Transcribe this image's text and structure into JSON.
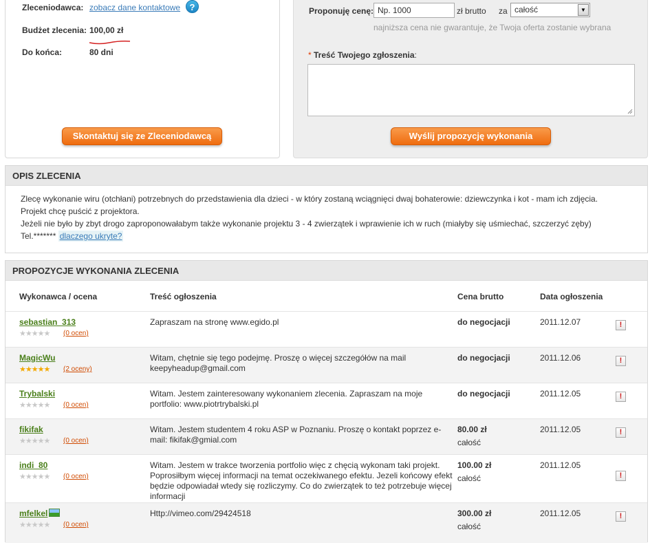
{
  "client": {
    "client_label": "Zleceniodawca:",
    "client_link": "zobacz dane kontaktowe",
    "help_icon": "?",
    "budget_label": "Budżet zlecenia:",
    "budget_value": "100,00 zł",
    "remaining_label": "Do końca:",
    "remaining_value": "80 dni",
    "contact_button": "Skontaktuj się ze Zleceniodawcą"
  },
  "proposal_form": {
    "price_label": "Proponuję cenę:",
    "price_placeholder": "Np. 1000",
    "brutto_label": "zł brutto",
    "za_label": "za",
    "scope_selected": "całość",
    "hint": "najniższa cena nie gwarantuje, że Twoja oferta zostanie wybrana",
    "required_mark": "*",
    "message_label": "Treść Twojego zgłoszenia",
    "colon": ":",
    "submit_button": "Wyślij propozycję wykonania"
  },
  "description": {
    "heading": "OPIS ZLECENIA",
    "lines": [
      "Zlecę wykonanie wiru (otchłani) potrzebnych do przedstawienia dla dzieci - w który zostaną wciągnięci dwaj bohaterowie: dziewczynka i kot - mam ich zdjęcia.",
      "Projekt chcę puścić z projektora.",
      "Jeżeli nie było by zbyt drogo zaproponowałabym także wykonanie projektu 3 - 4 zwierzątek i wprawienie ich w ruch (miałyby się uśmiechać, szczerzyć zęby)"
    ],
    "tel_label": "Tel.*******",
    "why_hidden_link": "dlaczego ukryte?"
  },
  "proposals": {
    "heading": "PROPOZYCJE WYKONANIA ZLECENIA",
    "columns": {
      "contractor": "Wykonawca / ocena",
      "content": "Treść ogłoszenia",
      "price": "Cena brutto",
      "date": "Data ogłoszenia"
    },
    "stars_glyph": "★★★★★",
    "report_icon": "!",
    "rows": [
      {
        "user": "sebastian_313",
        "rating_link": "(0 ocen)",
        "rating_stars": 0,
        "message": "Zapraszam na stronę www.egido.pl",
        "price": "do negocjacji",
        "price_sub": "",
        "date": "2011.12.07"
      },
      {
        "user": "MagicWu",
        "rating_link": "(2 oceny)",
        "rating_stars": 5,
        "message": "Witam, chętnie się tego podejmę. Proszę o więcej szczegółów na mail keepyheadup@gmail.com",
        "price": "do negocjacji",
        "price_sub": "",
        "date": "2011.12.06"
      },
      {
        "user": "Trybalski",
        "rating_link": "(0 ocen)",
        "rating_stars": 0,
        "message": "Witam. Jestem zainteresowany wykonaniem zlecenia. Zapraszam na moje portfolio: www.piotrtrybalski.pl",
        "price": "do negocjacji",
        "price_sub": "",
        "date": "2011.12.05"
      },
      {
        "user": "fikifak",
        "rating_link": "(0 ocen)",
        "rating_stars": 0,
        "message": "Witam. Jestem studentem 4 roku ASP w Poznaniu. Proszę o kontakt poprzez e-mail: fikifak@gmial.com",
        "price": "80.00 zł",
        "price_sub": "całość",
        "date": "2011.12.05"
      },
      {
        "user": "indi_80",
        "rating_link": "(0 ocen)",
        "rating_stars": 0,
        "message": "Witam. Jestem w trakce tworzenia portfolio więc z chęcią wykonam taki projekt. Poprosiłbym więcej informacji na temat oczekiwanego efektu. Jezeli końcowy efekt będzie odpowiadał wtedy się rozliczymy. Co do zwierzątek to też potrzebuje więcej informacji",
        "price": "100.00 zł",
        "price_sub": "całość",
        "date": "2011.12.05"
      },
      {
        "user": "mfelkel",
        "rating_link": "(0 ocen)",
        "rating_stars": 0,
        "message": "Http://vimeo.com/29424518",
        "price": "300.00 zł",
        "price_sub": "całość",
        "date": "2011.12.05"
      }
    ]
  }
}
